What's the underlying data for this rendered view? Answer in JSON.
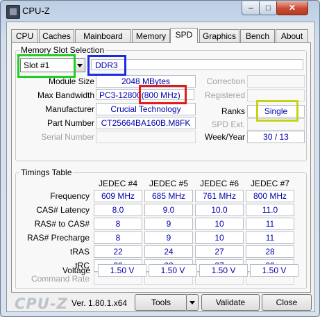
{
  "window": {
    "title": "CPU-Z"
  },
  "tabs": [
    "CPU",
    "Caches",
    "Mainboard",
    "Memory",
    "SPD",
    "Graphics",
    "Bench",
    "About"
  ],
  "slot_section": {
    "title": "Memory Slot Selection",
    "slot_value": "Slot #1",
    "memory_type": "DDR3",
    "module_size_label": "Module Size",
    "module_size": "2048 MBytes",
    "max_bandwidth_label": "Max Bandwidth",
    "max_bandwidth": "PC3-12800",
    "max_bandwidth_freq": "(800 MHz)",
    "manufacturer_label": "Manufacturer",
    "manufacturer": "Crucial Technology",
    "part_number_label": "Part Number",
    "part_number": "CT25664BA160B.M8FK",
    "serial_number_label": "Serial Number",
    "serial_number": "",
    "correction_label": "Correction",
    "registered_label": "Registered",
    "ranks_label": "Ranks",
    "ranks": "Single",
    "spd_ext_label": "SPD Ext.",
    "week_year_label": "Week/Year",
    "week_year": "30 / 13"
  },
  "timings": {
    "title": "Timings Table",
    "columns": [
      "JEDEC #4",
      "JEDEC #5",
      "JEDEC #6",
      "JEDEC #7"
    ],
    "rows": [
      {
        "label": "Frequency",
        "values": [
          "609 MHz",
          "685 MHz",
          "761 MHz",
          "800 MHz"
        ]
      },
      {
        "label": "CAS# Latency",
        "values": [
          "8.0",
          "9.0",
          "10.0",
          "11.0"
        ]
      },
      {
        "label": "RAS# to CAS#",
        "values": [
          "8",
          "9",
          "10",
          "11"
        ]
      },
      {
        "label": "RAS# Precharge",
        "values": [
          "8",
          "9",
          "10",
          "11"
        ]
      },
      {
        "label": "tRAS",
        "values": [
          "22",
          "24",
          "27",
          "28"
        ]
      },
      {
        "label": "tRC",
        "values": [
          "30",
          "33",
          "37",
          "39"
        ]
      },
      {
        "label": "Command Rate",
        "values": [
          "",
          "",
          "",
          ""
        ]
      },
      {
        "label": "Voltage",
        "values": [
          "1.50 V",
          "1.50 V",
          "1.50 V",
          "1.50 V"
        ]
      }
    ]
  },
  "footer": {
    "logo": "CPU-Z",
    "version": "Ver. 1.80.1.x64",
    "tools_label": "Tools",
    "validate_label": "Validate",
    "close_label": "Close"
  },
  "highlights": {
    "slot_color": "#22cc22",
    "type_color": "#1a2be0",
    "bandwidth_color": "#e01b1b",
    "ranks_color": "#c6d21a"
  },
  "colors": {
    "value_text": "#0000b0",
    "close_button": "#c8492f"
  }
}
